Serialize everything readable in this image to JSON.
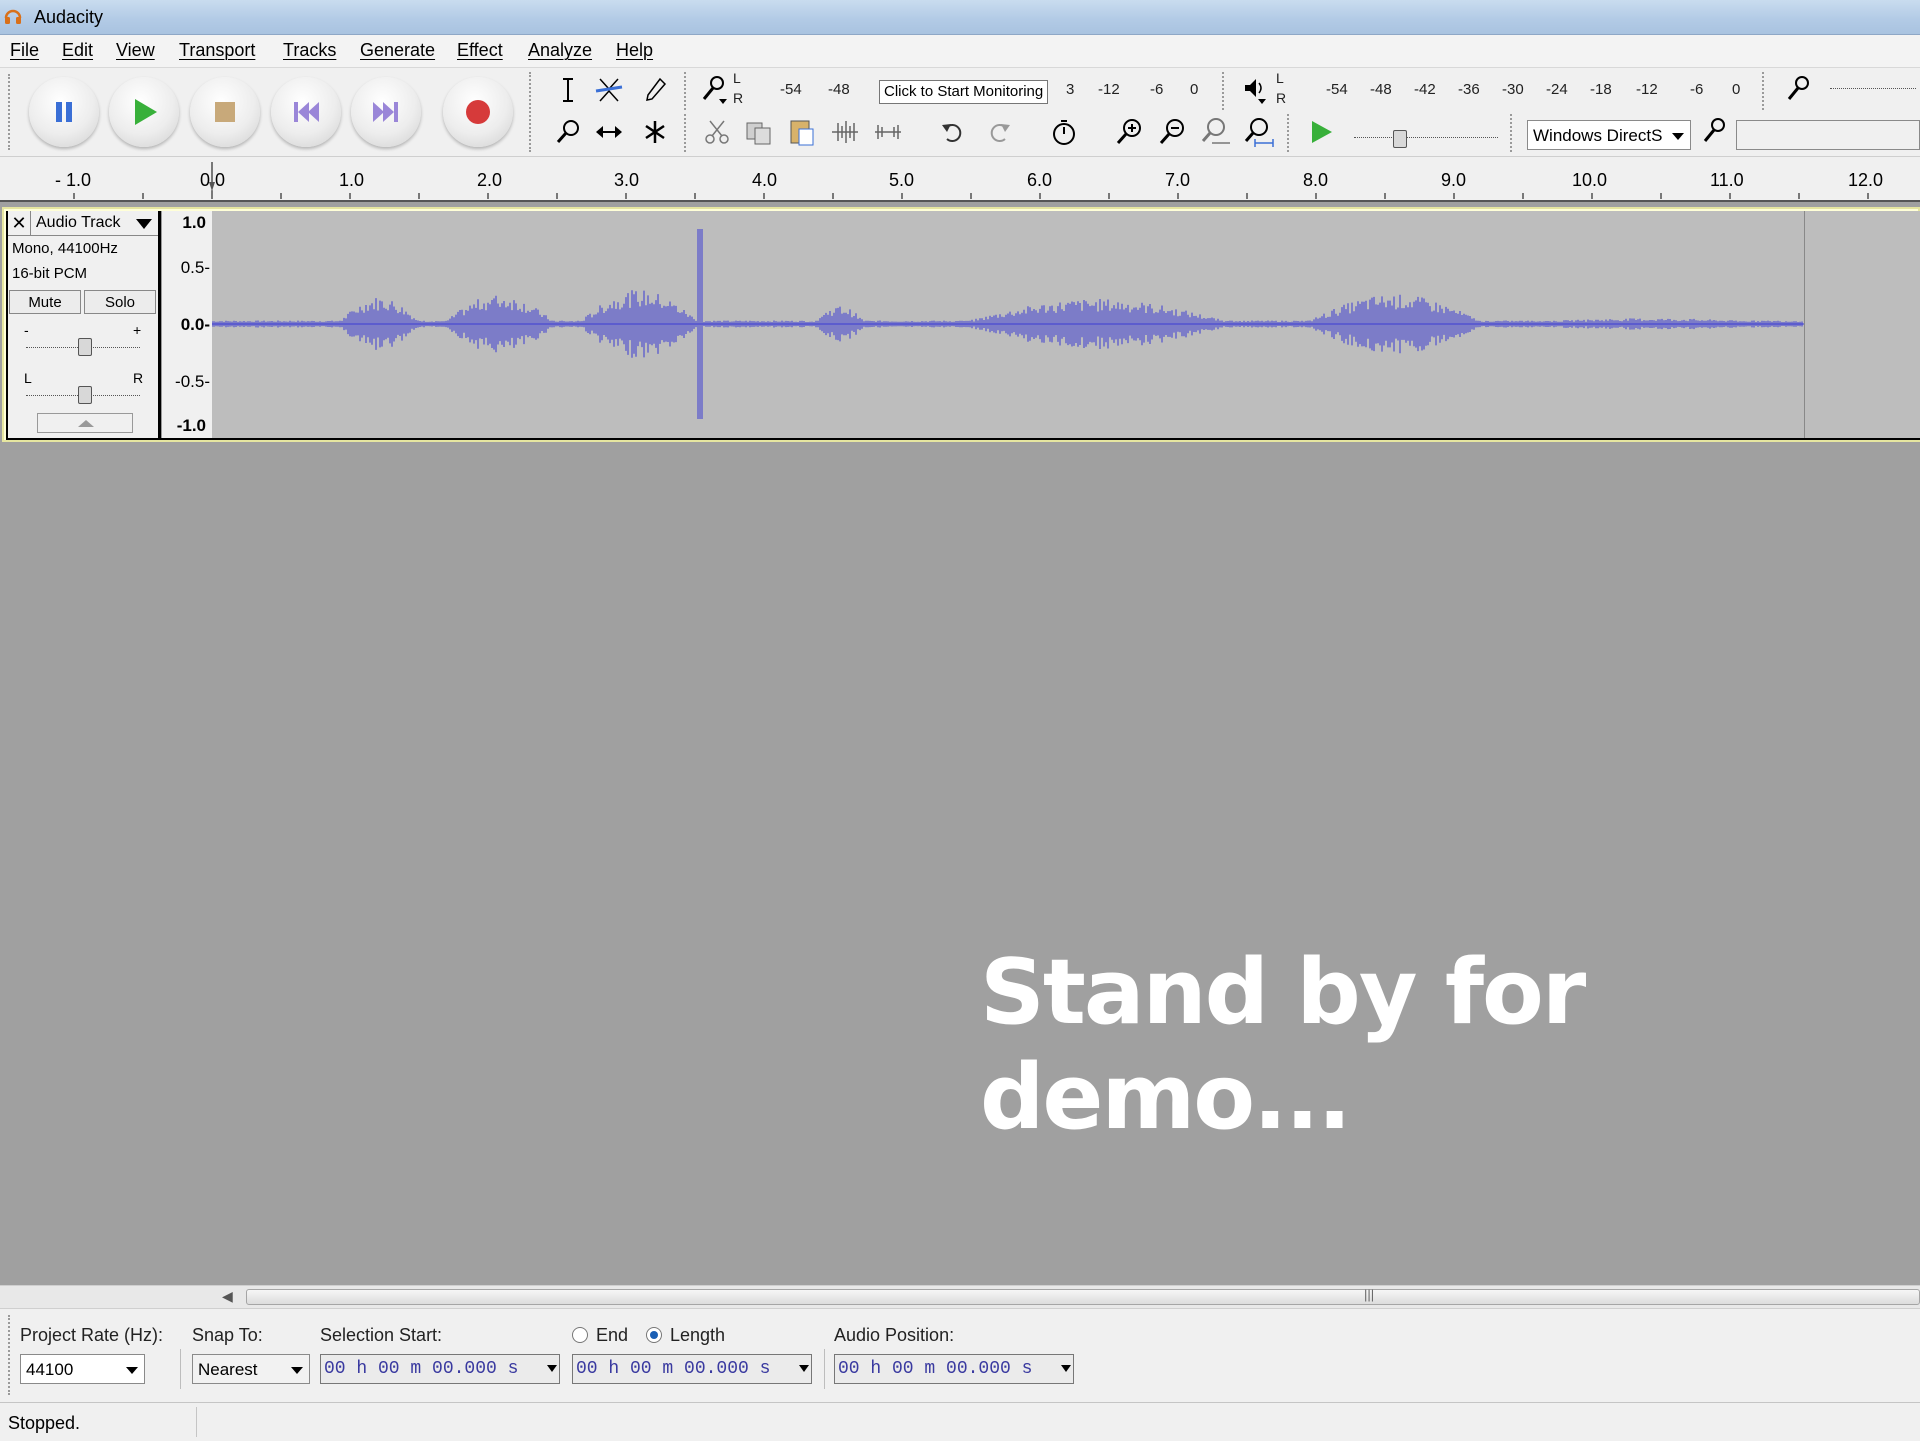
{
  "window": {
    "title": "Audacity"
  },
  "menu": {
    "items": [
      "File",
      "Edit",
      "View",
      "Transport",
      "Tracks",
      "Generate",
      "Effect",
      "Analyze",
      "Help"
    ]
  },
  "meters": {
    "record_ticks": [
      "-54",
      "-48",
      "3",
      "-12",
      "-6",
      "0"
    ],
    "play_ticks": [
      "-54",
      "-48",
      "-42",
      "-36",
      "-30",
      "-24",
      "-18",
      "-12",
      "-6",
      "0"
    ],
    "tooltip": "Click to Start Monitoring"
  },
  "device": {
    "host": "Windows DirectS"
  },
  "ruler": {
    "labels": [
      "- 1.0",
      "0.0",
      "1.0",
      "2.0",
      "3.0",
      "4.0",
      "5.0",
      "6.0",
      "7.0",
      "8.0",
      "9.0",
      "10.0",
      "11.0",
      "12.0"
    ]
  },
  "track": {
    "name": "Audio Track",
    "format_line1": "Mono, 44100Hz",
    "format_line2": "16-bit PCM",
    "mute_label": "Mute",
    "solo_label": "Solo",
    "gain_minus": "-",
    "gain_plus": "+",
    "pan_left": "L",
    "pan_right": "R",
    "vruler": [
      "1.0",
      "0.5-",
      "0.0-",
      "-0.5-",
      "-1.0"
    ]
  },
  "overlay": {
    "text": "Stand by for demo..."
  },
  "selection_bar": {
    "project_rate_label": "Project Rate (Hz):",
    "project_rate_value": "44100",
    "snap_to_label": "Snap To:",
    "snap_to_value": "Nearest",
    "selection_start_label": "Selection Start:",
    "end_label": "End",
    "length_label": "Length",
    "audio_position_label": "Audio Position:",
    "selection_start_value": "00 h 00 m 00.000 s",
    "length_value": "00 h 00 m 00.000 s",
    "audio_position_value": "00 h 00 m 00.000 s"
  },
  "status": {
    "text": "Stopped."
  },
  "colors": {
    "waveform": "#3c3cd4",
    "wave_background": "#bdbdbd",
    "workspace": "#a0a0a0"
  }
}
